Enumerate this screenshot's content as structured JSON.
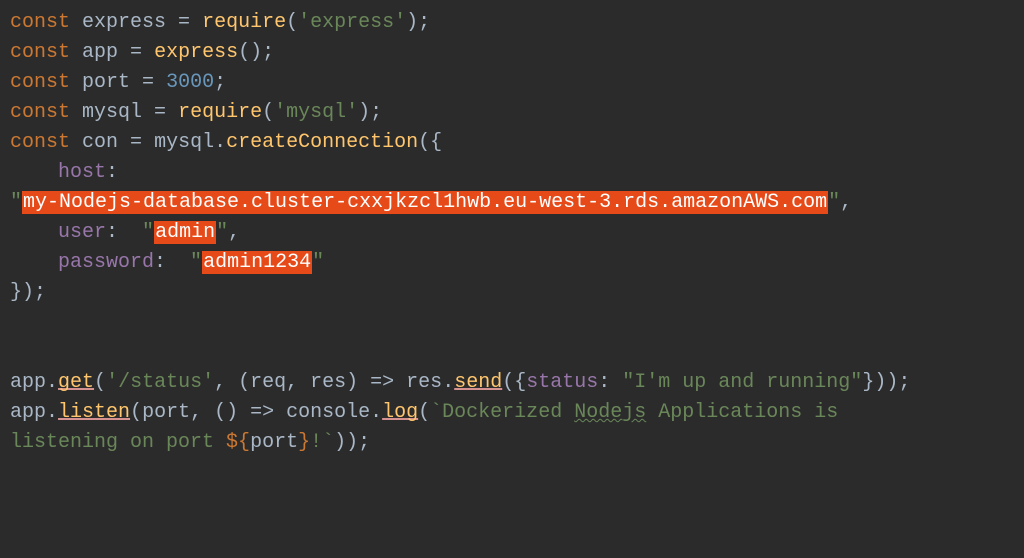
{
  "code": {
    "kw_const": "const",
    "var_express": "express",
    "eq": " = ",
    "fn_require": "require",
    "str_express": "'express'",
    "var_app": "app",
    "call_express": "express",
    "var_port": "port",
    "num_port": "3000",
    "var_mysql": "mysql",
    "str_mysql": "'mysql'",
    "var_con": "con",
    "mysql_ref": "mysql",
    "fn_createConnection": "createConnection",
    "key_host": "host",
    "host_value": "my-Nodejs-database.cluster-cxxjkzcl1hwb.eu-west-3.rds.amazonAWS.com",
    "key_user": "user",
    "user_value": "admin",
    "key_password": "password",
    "password_value": "admin1234",
    "app_ref": "app",
    "fn_get": "get",
    "str_status_path": "'/status'",
    "param_req": "req",
    "param_res": "res",
    "res_ref": "res",
    "fn_send": "send",
    "key_status": "status",
    "str_status_msg": "\"I'm up and running\"",
    "fn_listen": "listen",
    "console_ref": "console",
    "fn_log": "log",
    "tmpl_part1": "Dockerized ",
    "tmpl_nodejs": "Nodejs",
    "tmpl_part2": " Applications is ",
    "tmpl_part3": "listening on port ",
    "tmpl_open": "${",
    "tmpl_var_port": "port",
    "tmpl_close": "}",
    "tmpl_part4": "!"
  }
}
